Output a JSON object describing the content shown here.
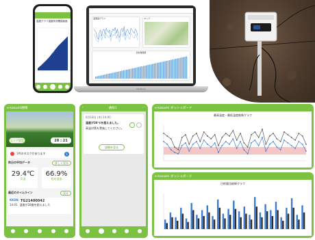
{
  "phone_top": {
    "title": "温度グラフ温度状況確認画面"
  },
  "laptop": {
    "panel1_title": "温湿度グラフ",
    "panel2_title": "マップ",
    "panel3_title": "日射量積算",
    "brand": "MacBook"
  },
  "sensor": {
    "label": "Kakashi"
  },
  "phone_home": {
    "app_title": "e-kakashi圃場",
    "pill_left": "エリア設定",
    "date_value": "28 : 21",
    "temp_unit": "℃",
    "task_text": "1件のタスクがあります",
    "task_count": "1",
    "avg_header": "昨日の平均データ",
    "avg_button": "詳しく見る",
    "temp_value": "29.4℃",
    "temp_label": "気温",
    "humid_value": "66.9%",
    "humid_label": "相対湿度",
    "timeline_header": "最近のタイムライン",
    "timeline_button": "見る",
    "tl_code": "KKDN",
    "tl_time": "14:01",
    "tl_id": "TG21400042",
    "tl_text": "温度が28度を超えました"
  },
  "phone_alert": {
    "title": "通知1",
    "date": "6月18日 (木) 14:00",
    "message_line1": "温度が30℃を超えました。",
    "message_line2": "高温対策を実施してください。",
    "button": "詳細を見る"
  },
  "dash1": {
    "title": "e-kakashi ダッシュボード",
    "chart_title": "最高温度・最低温度推移グラフ"
  },
  "dash2": {
    "title": "e-kakashi ダッシュボード",
    "chart_title": "日射量比較棒グラフ"
  },
  "colors": {
    "brand_green": "#7cc242",
    "chart_blue": "#3c7bd1",
    "chart_gray": "#555555",
    "band_pink": "#f4c6c6"
  },
  "chart_data": [
    {
      "type": "area",
      "title": "",
      "series": [
        {
          "name": "",
          "values": [
            5,
            9,
            12,
            16,
            20,
            24,
            28,
            32,
            37,
            42,
            47,
            52,
            57,
            62,
            66,
            70,
            74,
            78,
            82,
            86
          ]
        }
      ]
    },
    {
      "type": "line",
      "title": "最高温度・最低温度推移グラフ",
      "series": [
        {
          "name": "",
          "values": [
            30,
            28,
            26,
            20,
            18,
            27,
            29,
            22,
            28,
            30,
            24,
            31,
            28,
            26,
            29,
            21,
            27,
            30,
            28,
            32,
            25,
            30,
            23,
            20,
            29,
            31,
            27,
            33,
            22,
            28,
            30,
            26,
            24,
            31,
            29,
            27,
            25,
            30,
            28,
            22
          ]
        },
        {
          "name": "",
          "values": [
            24,
            22,
            18,
            16,
            15,
            21,
            23,
            17,
            22,
            24,
            19,
            25,
            22,
            20,
            23,
            16,
            21,
            24,
            22,
            26,
            19,
            24,
            18,
            15,
            23,
            25,
            21,
            27,
            17,
            22,
            24,
            20,
            18,
            25,
            23,
            21,
            19,
            24,
            22,
            17
          ]
        }
      ]
    },
    {
      "type": "bar",
      "title": "日射量比較棒グラフ",
      "series": [
        {
          "name": "",
          "values": [
            8,
            14,
            10,
            18,
            9,
            22,
            12,
            16,
            20,
            11,
            25,
            13,
            17,
            24,
            15,
            19,
            12,
            27,
            14,
            21,
            16,
            23,
            10,
            18,
            26,
            12,
            20
          ]
        },
        {
          "name": "",
          "values": [
            5,
            10,
            7,
            13,
            6,
            16,
            9,
            11,
            14,
            8,
            18,
            9,
            12,
            17,
            10,
            13,
            8,
            19,
            10,
            15,
            11,
            16,
            7,
            13,
            18,
            8,
            14
          ]
        }
      ]
    }
  ]
}
